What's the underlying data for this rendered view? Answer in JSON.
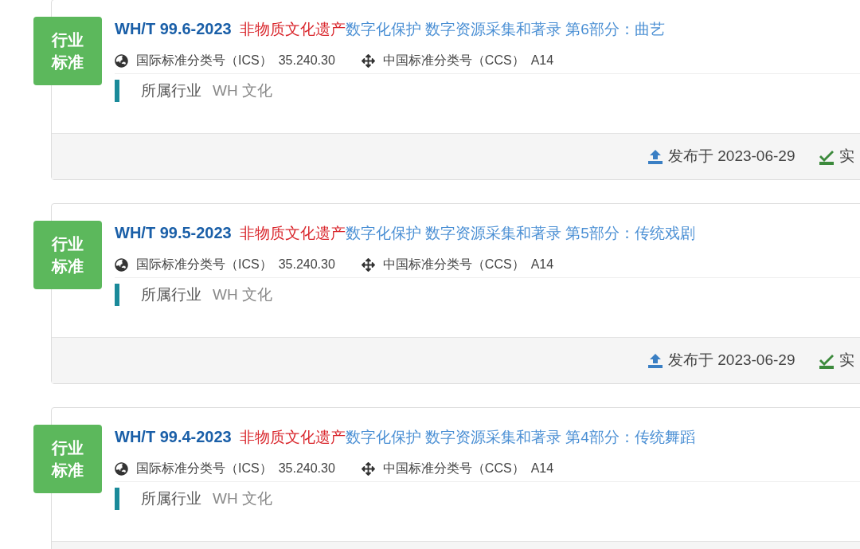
{
  "standards": [
    {
      "badge": [
        "行业",
        "标准"
      ],
      "code": "WH/T 99.6-2023",
      "highlight": "非物质文化遗产",
      "rest": "数字化保护 数字资源采集和著录 第6部分：曲艺",
      "ics_label": "国际标准分类号（ICS）",
      "ics": "35.240.30",
      "ccs_label": "中国标准分类号（CCS）",
      "ccs": "A14",
      "industry_label": "所属行业",
      "industry": "WH 文化",
      "published": "发布于 2023-06-29",
      "implemented": "实"
    },
    {
      "badge": [
        "行业",
        "标准"
      ],
      "code": "WH/T 99.5-2023",
      "highlight": "非物质文化遗产",
      "rest": "数字化保护 数字资源采集和著录 第5部分：传统戏剧",
      "ics_label": "国际标准分类号（ICS）",
      "ics": "35.240.30",
      "ccs_label": "中国标准分类号（CCS）",
      "ccs": "A14",
      "industry_label": "所属行业",
      "industry": "WH 文化",
      "published": "发布于 2023-06-29",
      "implemented": "实"
    },
    {
      "badge": [
        "行业",
        "标准"
      ],
      "code": "WH/T 99.4-2023",
      "highlight": "非物质文化遗产",
      "rest": "数字化保护 数字资源采集和著录 第4部分：传统舞蹈",
      "ics_label": "国际标准分类号（ICS）",
      "ics": "35.240.30",
      "ccs_label": "中国标准分类号（CCS）",
      "ccs": "A14",
      "industry_label": "所属行业",
      "industry": "WH 文化"
    }
  ]
}
